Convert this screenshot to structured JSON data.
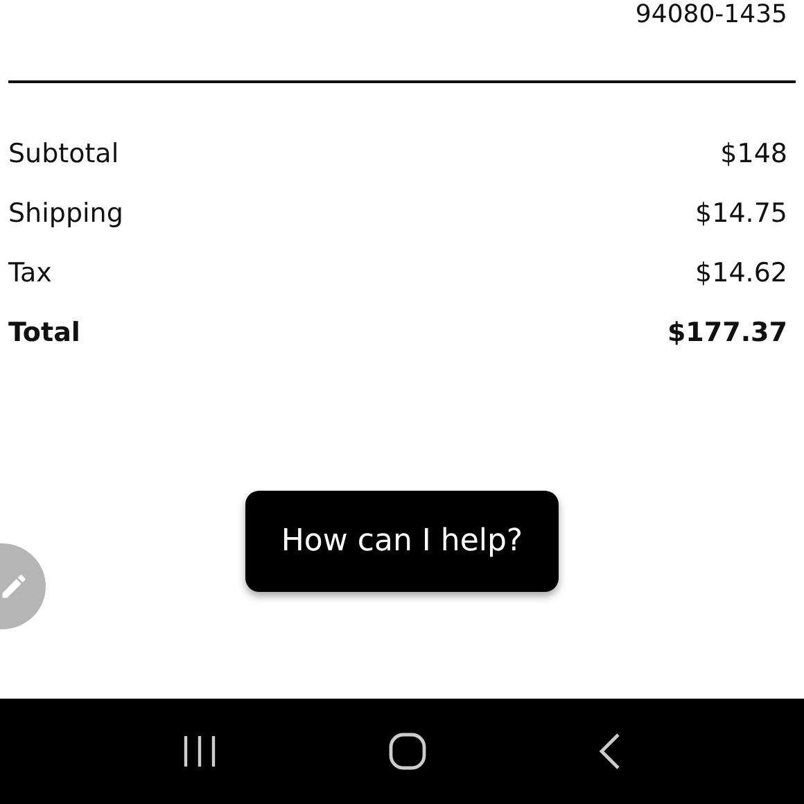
{
  "address": {
    "postal_code": "94080-1435"
  },
  "summary": [
    {
      "kind": "line",
      "label": "Subtotal",
      "amount": "$148"
    },
    {
      "kind": "line",
      "label": "Shipping",
      "amount": "$14.75"
    },
    {
      "kind": "line",
      "label": "Tax",
      "amount": "$14.62"
    },
    {
      "kind": "total",
      "label": "Total",
      "amount": "$177.37"
    }
  ],
  "chat_prompt": {
    "text": "How can I help?"
  },
  "nav_bar": {
    "buttons": [
      {
        "kind": "recents"
      },
      {
        "kind": "home"
      },
      {
        "kind": "back"
      }
    ]
  }
}
